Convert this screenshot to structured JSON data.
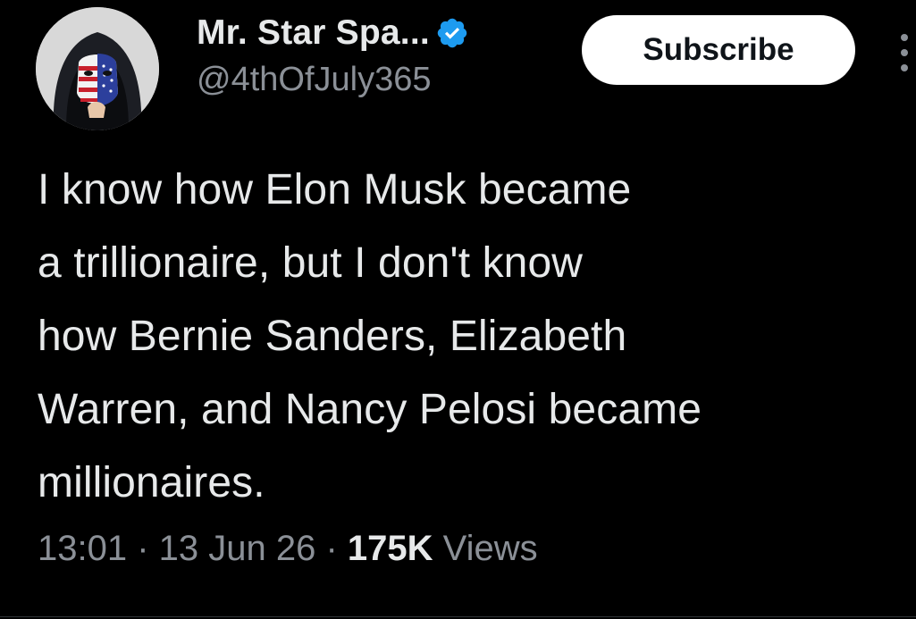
{
  "author": {
    "display_name": "Mr. Star Spa...",
    "handle": "@4thOfJuly365",
    "verified": true,
    "avatar_icon": "masked-person-avatar"
  },
  "actions": {
    "subscribe_label": "Subscribe",
    "more_icon": "vertical-dots-icon"
  },
  "tweet": {
    "lines": [
      "I know how Elon Musk became",
      "a trillionaire, but I don't know",
      "how Bernie Sanders, Elizabeth",
      "Warren, and Nancy Pelosi became",
      "millionaires."
    ]
  },
  "meta": {
    "time": "13:01",
    "separator": " · ",
    "date": "13 Jun 26",
    "views_count": "175K",
    "views_label": " Views"
  },
  "colors": {
    "background": "#000000",
    "primary_text": "#e7e9ea",
    "secondary_text": "#8b9097",
    "verified_blue": "#1d9bf0",
    "subscribe_bg": "#ffffff"
  }
}
